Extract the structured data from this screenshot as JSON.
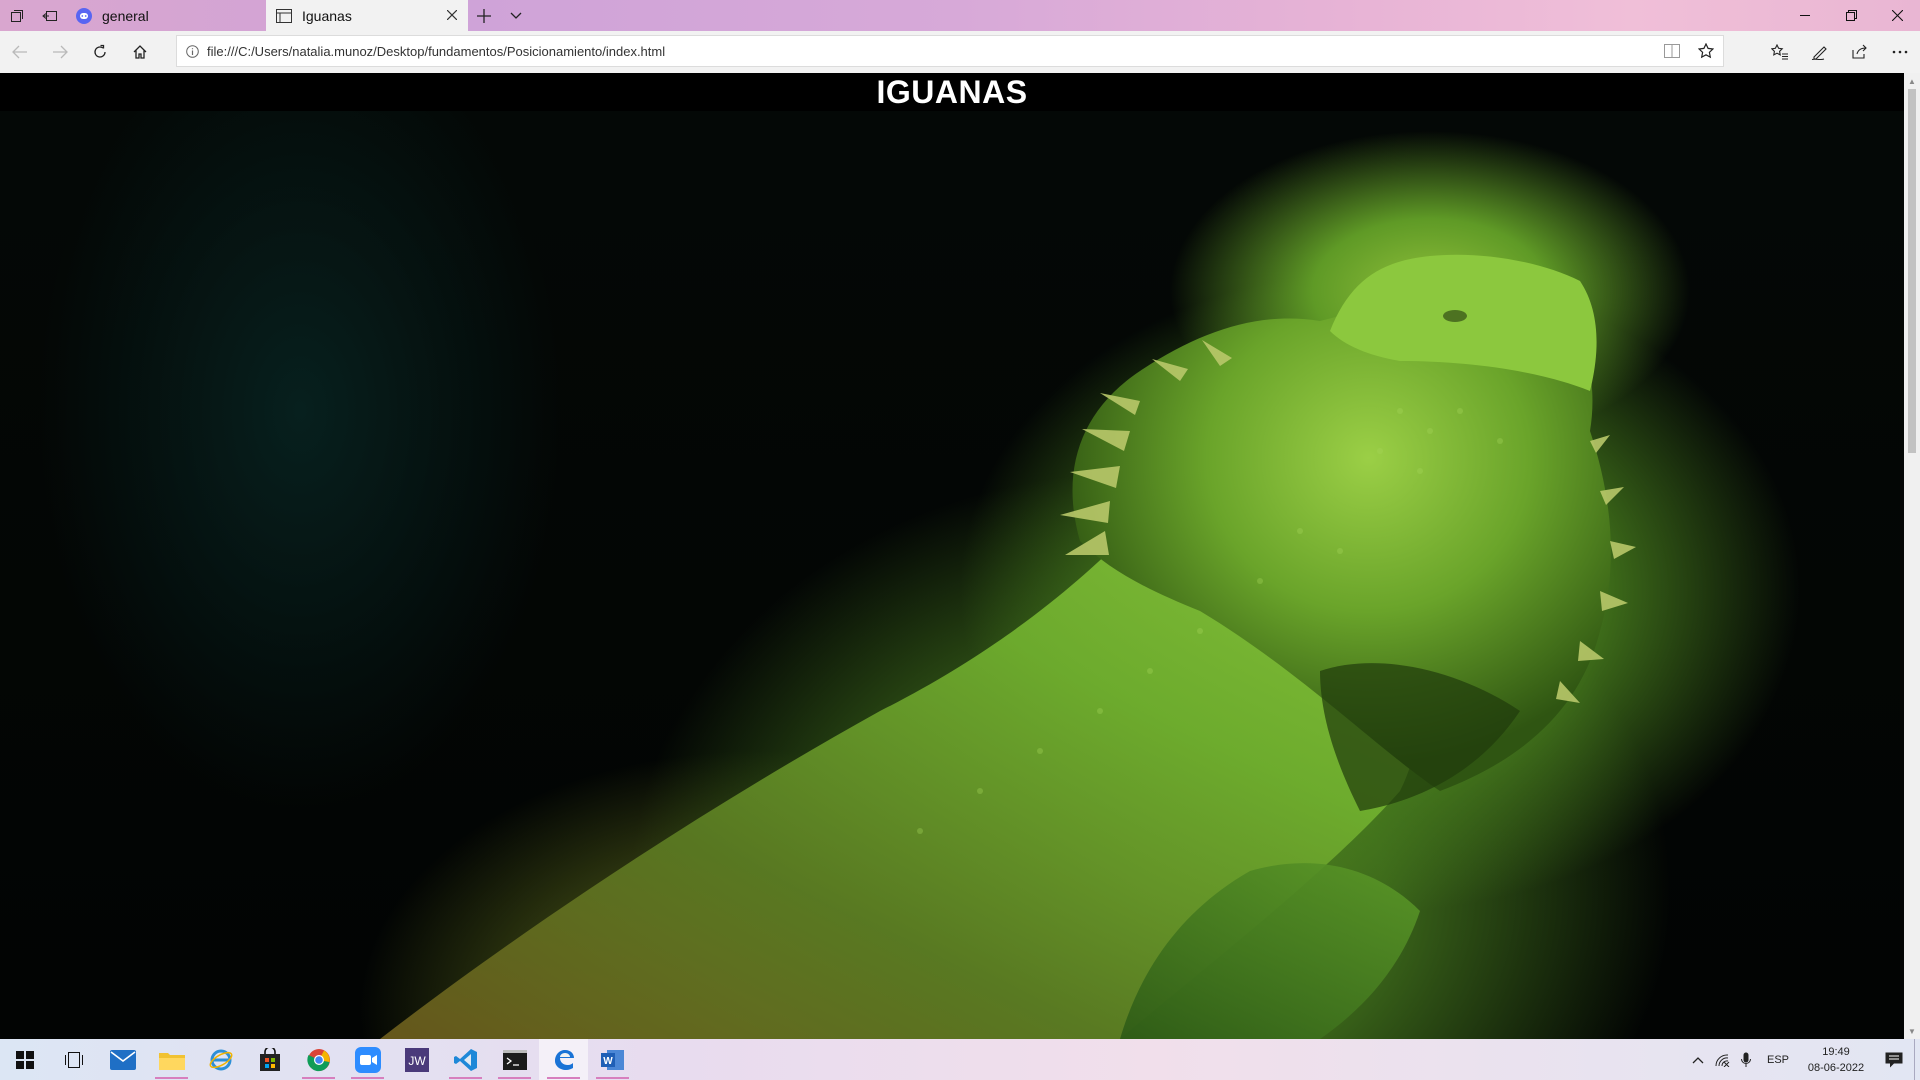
{
  "browser": {
    "tabs": [
      {
        "label": "general",
        "active": false
      },
      {
        "label": "Iguanas",
        "active": true
      }
    ],
    "address": "file:///C:/Users/natalia.munoz/Desktop/fundamentos/Posicionamiento/index.html"
  },
  "page": {
    "title": "IGUANAS"
  },
  "taskbar": {
    "apps": [
      "start-icon",
      "task-view-icon",
      "mail-icon",
      "file-explorer-icon",
      "internet-explorer-icon",
      "store-icon",
      "chrome-icon",
      "zoom-icon",
      "jw-library-icon",
      "vscode-icon",
      "terminal-icon",
      "edge-icon",
      "word-icon"
    ],
    "language": "ESP",
    "time": "19:49",
    "date": "08-06-2022"
  },
  "colors": {
    "tab_strip": "#d9a6cf",
    "toolbar": "#f2f2f2",
    "page_bg": "#000000",
    "iguana_green": "#6fae2e"
  }
}
